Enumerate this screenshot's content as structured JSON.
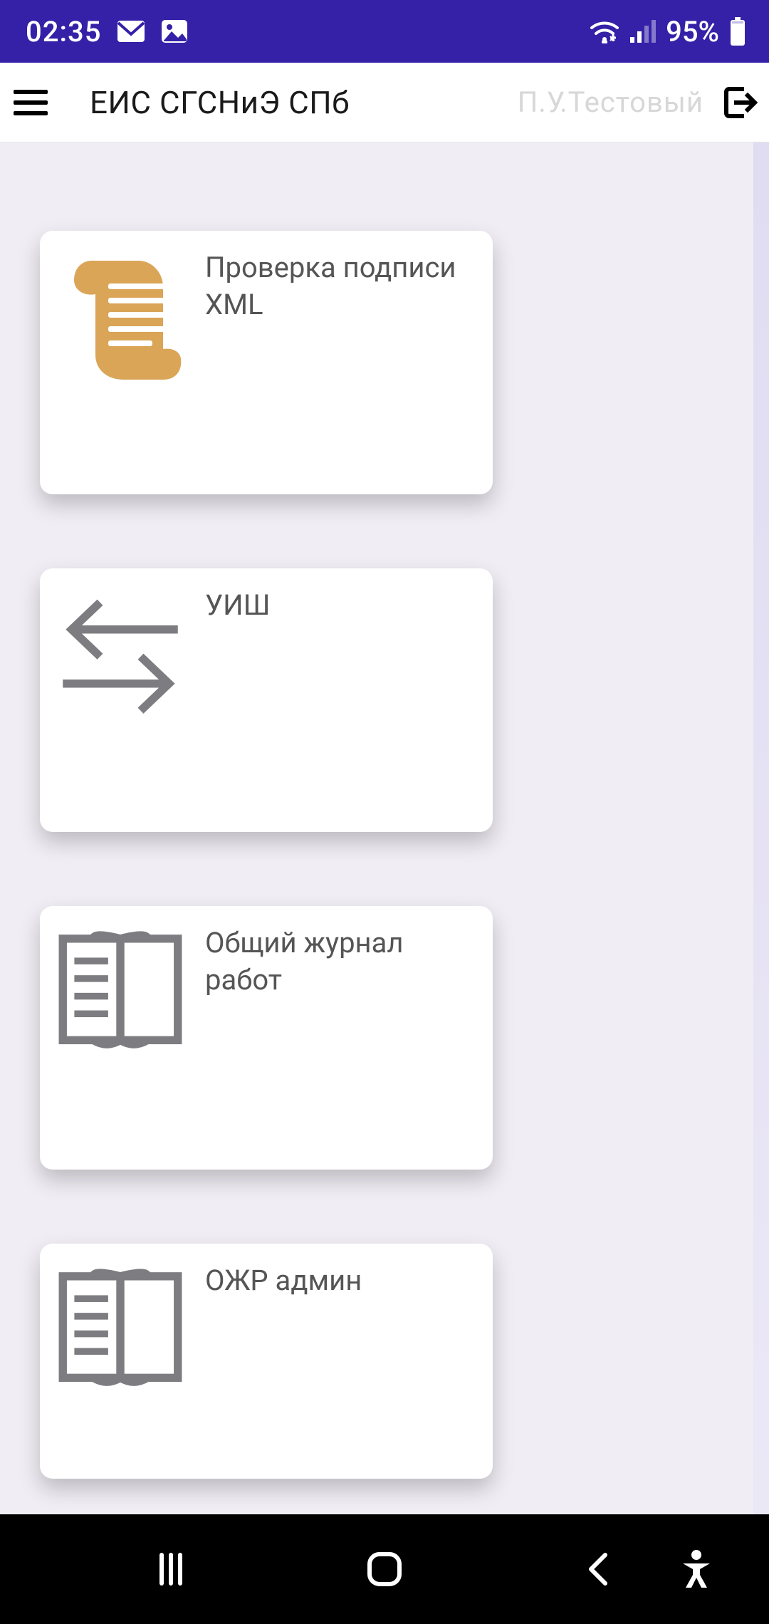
{
  "status": {
    "time": "02:35",
    "battery": "95%"
  },
  "header": {
    "title": "ЕИС СГСНиЭ СПб",
    "user": "П.У.Тестовый"
  },
  "cards": [
    {
      "title": "Проверка подписи XML",
      "icon": "scroll"
    },
    {
      "title": "УИШ",
      "icon": "arrows"
    },
    {
      "title": "Общий журнал работ",
      "icon": "book"
    },
    {
      "title": "ОЖР админ",
      "icon": "book"
    }
  ]
}
